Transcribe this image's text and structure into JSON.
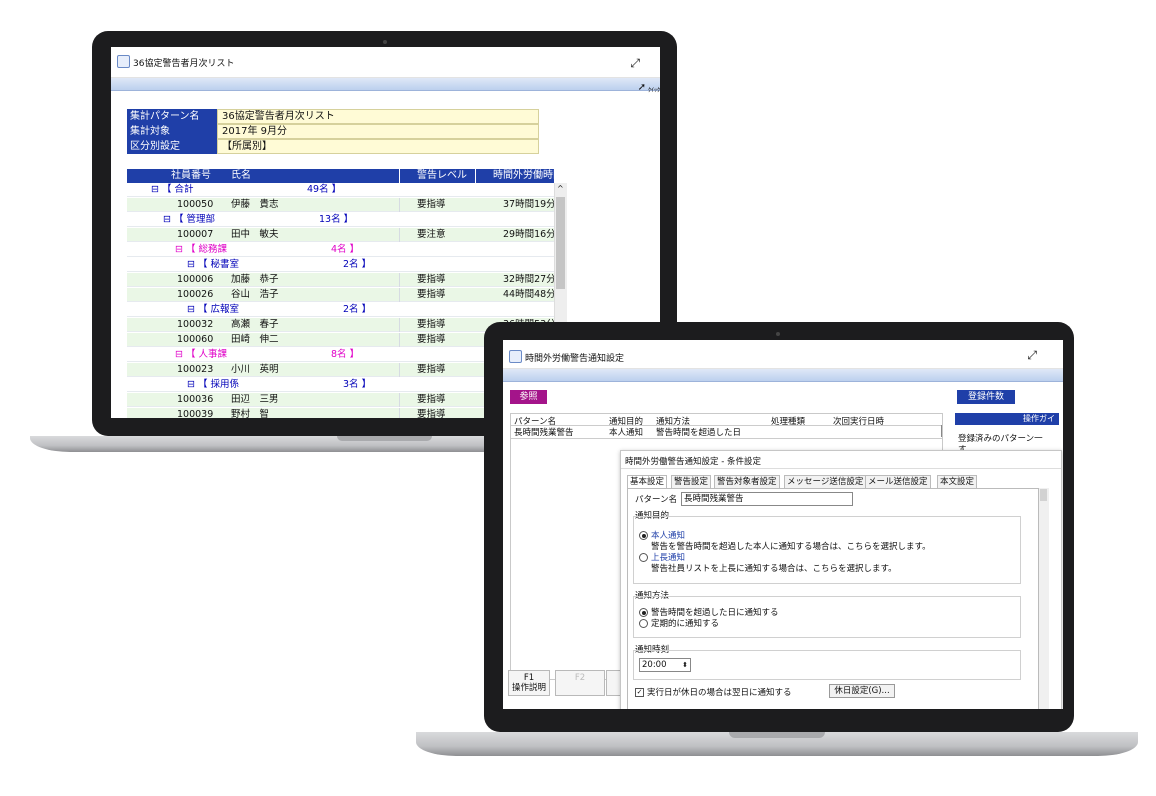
{
  "window1": {
    "title": "36協定警告者月次リスト",
    "quick_label": "ｸｲｯｸ",
    "info": [
      {
        "label": "集計パターン名",
        "value": "36協定警告者月次リスト"
      },
      {
        "label": "集計対象",
        "value": "2017年 9月分"
      },
      {
        "label": "区分別設定",
        "value": "【所属別】"
      }
    ],
    "table": {
      "headers": [
        "社員番号",
        "氏名",
        "警告レベル",
        "時間外労働時間"
      ],
      "rows": [
        {
          "kind": "group",
          "tone": "blue",
          "indent": 0,
          "text": "⊟ 【 合計",
          "count": "49名 】"
        },
        {
          "kind": "data",
          "id": "100050",
          "name": "伊藤　貴志",
          "level": "要指導",
          "hours": "37時間19分"
        },
        {
          "kind": "group",
          "tone": "blue",
          "indent": 1,
          "text": "⊟ 【 管理部",
          "count": "13名 】"
        },
        {
          "kind": "data",
          "id": "100007",
          "name": "田中　敏夫",
          "level": "要注意",
          "hours": "29時間16分"
        },
        {
          "kind": "group",
          "tone": "pink",
          "indent": 2,
          "text": "⊟ 【 総務課",
          "count": "4名 】"
        },
        {
          "kind": "group",
          "tone": "blue",
          "indent": 3,
          "text": "⊟ 【 秘書室",
          "count": "2名 】"
        },
        {
          "kind": "data",
          "id": "100006",
          "name": "加藤　恭子",
          "level": "要指導",
          "hours": "32時間27分"
        },
        {
          "kind": "data",
          "id": "100026",
          "name": "谷山　浩子",
          "level": "要指導",
          "hours": "44時間48分"
        },
        {
          "kind": "group",
          "tone": "blue",
          "indent": 3,
          "text": "⊟ 【 広報室",
          "count": "2名 】"
        },
        {
          "kind": "data",
          "id": "100032",
          "name": "高瀬　春子",
          "level": "要指導",
          "hours": "36時間53分"
        },
        {
          "kind": "data",
          "id": "100060",
          "name": "田崎　伸二",
          "level": "要指導",
          "hours": ""
        },
        {
          "kind": "group",
          "tone": "pink",
          "indent": 2,
          "text": "⊟ 【 人事課",
          "count": "8名 】"
        },
        {
          "kind": "data",
          "id": "100023",
          "name": "小川　英明",
          "level": "要指導",
          "hours": ""
        },
        {
          "kind": "group",
          "tone": "blue",
          "indent": 3,
          "text": "⊟ 【 採用係",
          "count": "3名 】"
        },
        {
          "kind": "data",
          "id": "100036",
          "name": "田辺　三男",
          "level": "要指導",
          "hours": ""
        },
        {
          "kind": "data",
          "id": "100039",
          "name": "野村　智",
          "level": "要指導",
          "hours": ""
        }
      ]
    }
  },
  "window2": {
    "title": "時間外労働警告通知設定",
    "ref_button": "参照",
    "count_button": "登録件数",
    "guide_header": "操作ガイ",
    "guide_text": "登録済みのパターン一",
    "guide_text2": "す",
    "list_headers": [
      "パターン名",
      "通知目的",
      "通知方法",
      "処理種類",
      "次回実行日時"
    ],
    "list_row": [
      "長時間残業警告",
      "本人通知",
      "警告時間を超過した日",
      "",
      ""
    ],
    "fkey1_top": "F1",
    "fkey1_bottom": "操作説明",
    "fkey2": "F2",
    "dialog": {
      "title": "時間外労働警告通知設定 - 条件設定",
      "tabs": [
        "基本設定",
        "警告設定",
        "警告対象者設定",
        "メッセージ送信設定",
        "メール送信設定",
        "本文設定"
      ],
      "pattern_label": "パターン名",
      "pattern_value": "長時間残業警告",
      "purpose_title": "通知目的",
      "opt_self": "本人通知",
      "opt_self_desc": "警告を警告時間を超過した本人に通知する場合は、こちらを選択します。",
      "opt_boss": "上長通知",
      "opt_boss_desc": "警告社員リストを上長に通知する場合は、こちらを選択します。",
      "method_title": "通知方法",
      "method_opt1": "警告時間を超過した日に通知する",
      "method_opt2": "定期的に通知する",
      "time_title": "通知時刻",
      "time_value": "20:00",
      "holiday_check": "実行日が休日の場合は翌日に通知する",
      "holiday_button": "休日設定(G)..."
    }
  }
}
